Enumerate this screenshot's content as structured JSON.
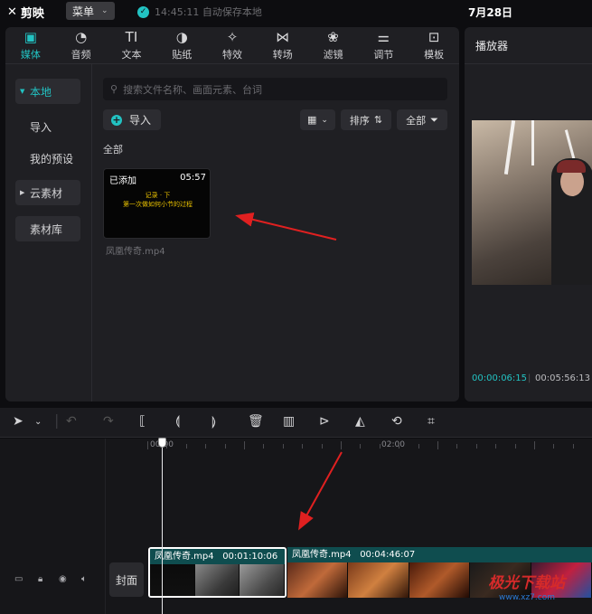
{
  "topbar": {
    "app_name": "剪映",
    "menu_label": "菜单",
    "save_status": "14:45:11 自动保存本地",
    "date": "7月28日"
  },
  "media_tabs": [
    {
      "label": "媒体",
      "icon": "media-icon",
      "glyph": "▣",
      "active": true
    },
    {
      "label": "音频",
      "icon": "audio-icon",
      "glyph": "◔",
      "active": false
    },
    {
      "label": "文本",
      "icon": "text-icon",
      "glyph": "TI",
      "active": false
    },
    {
      "label": "贴纸",
      "icon": "sticker-icon",
      "glyph": "◑",
      "active": false
    },
    {
      "label": "特效",
      "icon": "effects-icon",
      "glyph": "✧",
      "active": false
    },
    {
      "label": "转场",
      "icon": "transition-icon",
      "glyph": "⋈",
      "active": false
    },
    {
      "label": "滤镜",
      "icon": "filter-icon",
      "glyph": "❀",
      "active": false
    },
    {
      "label": "调节",
      "icon": "adjust-icon",
      "glyph": "⚌",
      "active": false
    },
    {
      "label": "模板",
      "icon": "template-icon",
      "glyph": "⊡",
      "active": false
    }
  ],
  "sidebar": {
    "items": [
      {
        "label": "本地"
      },
      {
        "label": "导入"
      },
      {
        "label": "我的预设"
      },
      {
        "label": "云素材"
      },
      {
        "label": "素材库"
      }
    ]
  },
  "media": {
    "search_placeholder": "搜索文件名称、画面元素、台词",
    "import_label": "导入",
    "sort_label": "排序",
    "filter_label": "全部",
    "section_label": "全部",
    "item": {
      "added_badge": "已添加",
      "duration": "05:57",
      "subtitle_line1": "记录 · 下",
      "subtitle_line2": "第一次做如何小节的过程",
      "file_name": "凤凰传奇.mp4"
    }
  },
  "player": {
    "title": "播放器",
    "current_time": "00:00:06:15",
    "total_time": "00:05:56:13"
  },
  "timeline": {
    "ruler_labels": [
      "00:00",
      "02:00"
    ],
    "cover_label": "封面",
    "clips": [
      {
        "name": "凤凰传奇.mp4",
        "duration": "00:01:10:06"
      },
      {
        "name": "凤凰传奇.mp4",
        "duration": "00:04:46:07"
      }
    ]
  },
  "watermark": {
    "title": "极光下载站",
    "url": "www.xz7.com"
  },
  "colors": {
    "accent": "#22c3c3",
    "panel": "#1f1f23",
    "clip": "#0f4d4f",
    "annotation_arrow": "#e02020"
  }
}
